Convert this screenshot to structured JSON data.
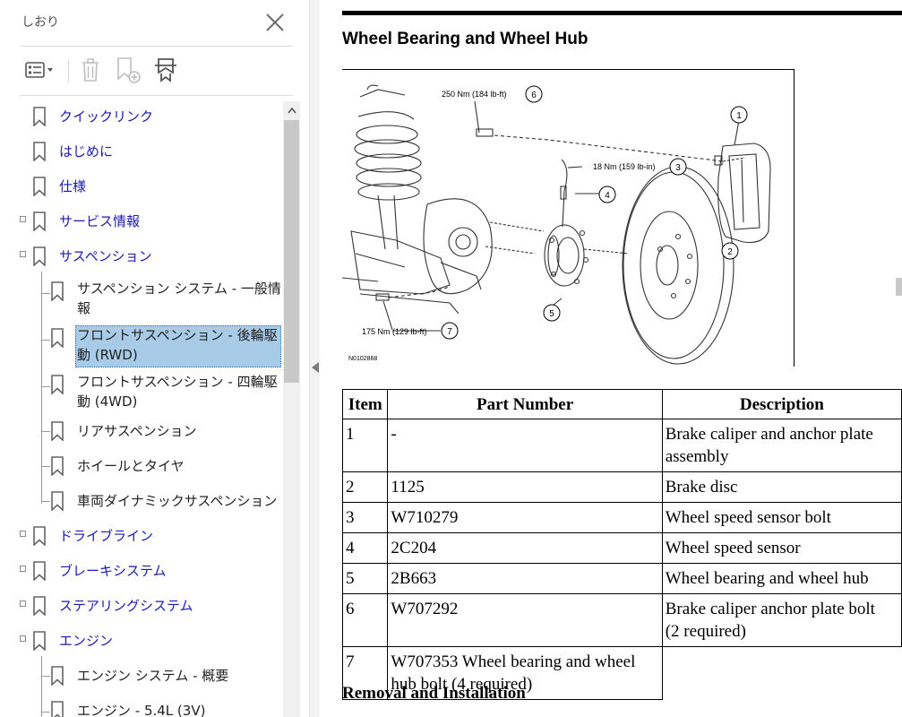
{
  "sidebar": {
    "title": "しおり",
    "items": [
      {
        "label": "クイックリンク",
        "level": 0,
        "expandable": false
      },
      {
        "label": "はじめに",
        "level": 0,
        "expandable": false
      },
      {
        "label": "仕様",
        "level": 0,
        "expandable": false
      },
      {
        "label": "サービス情報",
        "level": 0,
        "expandable": true
      },
      {
        "label": "サスペンション",
        "level": 0,
        "expandable": true
      },
      {
        "label": "サスペンション システム - 一般情報",
        "level": 1,
        "expandable": false
      },
      {
        "label": "フロントサスペンション - 後輪駆動 (RWD)",
        "level": 1,
        "expandable": false,
        "selected": true
      },
      {
        "label": "フロントサスペンション - 四輪駆動 (4WD)",
        "level": 1,
        "expandable": false
      },
      {
        "label": "リアサスペンション",
        "level": 1,
        "expandable": false
      },
      {
        "label": "ホイールとタイヤ",
        "level": 1,
        "expandable": false
      },
      {
        "label": "車両ダイナミックサスペンション",
        "level": 1,
        "expandable": false
      },
      {
        "label": "ドライブライン",
        "level": 0,
        "expandable": true
      },
      {
        "label": "ブレーキシステム",
        "level": 0,
        "expandable": true
      },
      {
        "label": "ステアリングシステム",
        "level": 0,
        "expandable": true
      },
      {
        "label": "エンジン",
        "level": 0,
        "expandable": true
      },
      {
        "label": "エンジン システム - 概要",
        "level": 1,
        "expandable": false
      },
      {
        "label": "エンジン - 5.4L (3V)",
        "level": 1,
        "expandable": false
      }
    ]
  },
  "colors": {
    "link": "#1a1ab4",
    "selected_bg": "#a8cbe8",
    "selected_border": "#5a8fc4"
  },
  "document": {
    "title": "Wheel Bearing and Wheel Hub",
    "figure": {
      "id_label": "N0102868",
      "callouts": [
        {
          "num": "1"
        },
        {
          "num": "2"
        },
        {
          "num": "3",
          "torque": "18 Nm (159 lb-in)"
        },
        {
          "num": "4"
        },
        {
          "num": "5"
        },
        {
          "num": "6",
          "torque": "250 Nm (184 lb-ft)"
        },
        {
          "num": "7",
          "torque": "175 Nm (129 lb-ft)"
        }
      ]
    },
    "table": {
      "headers": [
        "Item",
        "Part Number",
        "Description"
      ],
      "rows": [
        {
          "item": "1",
          "part": "-",
          "desc": [
            "Brake caliper and anchor plate",
            "assembly"
          ]
        },
        {
          "item": "2",
          "part": "1125",
          "desc": [
            "Brake disc"
          ]
        },
        {
          "item": "3",
          "part": "W710279",
          "desc": [
            "Wheel speed sensor bolt"
          ]
        },
        {
          "item": "4",
          "part": "2C204",
          "desc": [
            "Wheel speed sensor"
          ]
        },
        {
          "item": "5",
          "part": "2B663",
          "desc": [
            "Wheel bearing and wheel hub"
          ]
        },
        {
          "item": "6",
          "part": "W707292",
          "desc": [
            "Brake caliper anchor plate bolt",
            "(2 required)"
          ]
        },
        {
          "item": "7",
          "part": "W707353 Wheel bearing and wheel hub bolt (4 required)",
          "desc": []
        }
      ]
    },
    "next_heading": "Removal and Installation"
  }
}
